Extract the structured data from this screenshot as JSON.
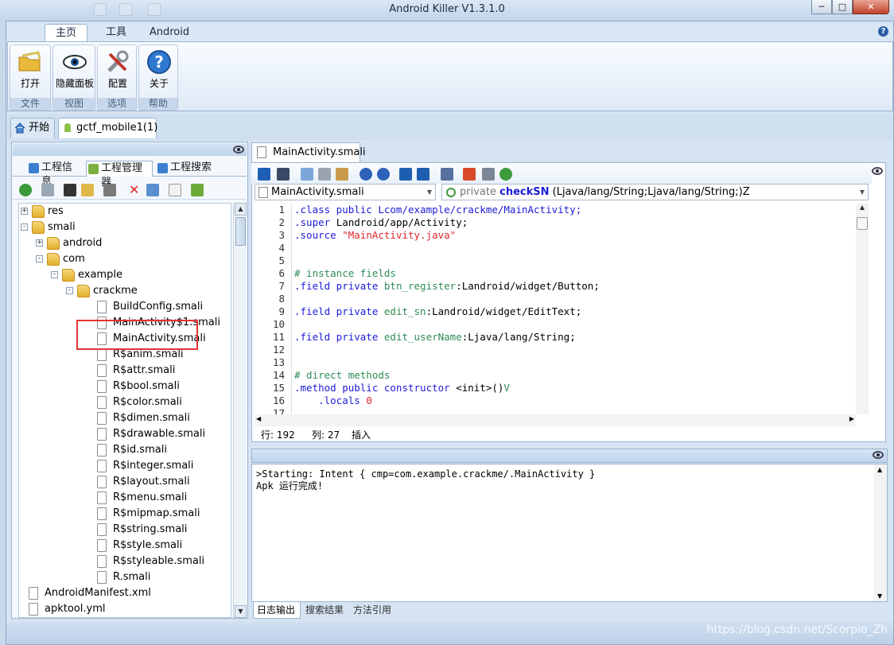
{
  "window": {
    "title": "Android Killer V1.3.1.0",
    "min_label": "─",
    "max_label": "□",
    "close_label": "✕"
  },
  "ribbon": {
    "tabs": [
      {
        "label": "主页"
      },
      {
        "label": "工具"
      },
      {
        "label": "Android"
      }
    ],
    "help_label": "?",
    "groups": [
      {
        "button": "打开",
        "label": "文件",
        "icon": "open-folder-icon"
      },
      {
        "button": "隐藏面板",
        "label": "视图",
        "icon": "eye-icon"
      },
      {
        "button": "配置",
        "label": "选项",
        "icon": "tools-icon"
      },
      {
        "button": "关于",
        "label": "帮助",
        "icon": "help-icon"
      }
    ]
  },
  "doc_tabs": [
    {
      "label": "开始",
      "icon": "home-icon"
    },
    {
      "label": "gctf_mobile1(1)",
      "icon": "android-icon"
    }
  ],
  "left_panel": {
    "tabs": [
      {
        "label": "工程信息"
      },
      {
        "label": "工程管理器"
      },
      {
        "label": "工程搜索"
      }
    ],
    "tree": [
      {
        "label": "res",
        "type": "folder",
        "level": 0,
        "toggle": "+"
      },
      {
        "label": "smali",
        "type": "folder",
        "level": 0,
        "toggle": "-"
      },
      {
        "label": "android",
        "type": "folder",
        "level": 1,
        "toggle": "+"
      },
      {
        "label": "com",
        "type": "folder",
        "level": 1,
        "toggle": "-"
      },
      {
        "label": "example",
        "type": "folder",
        "level": 2,
        "toggle": "-"
      },
      {
        "label": "crackme",
        "type": "folder",
        "level": 3,
        "toggle": "-"
      },
      {
        "label": "BuildConfig.smali",
        "type": "file",
        "level": 4
      },
      {
        "label": "MainActivity$1.smali",
        "type": "file",
        "level": 4
      },
      {
        "label": "MainActivity.smali",
        "type": "file",
        "level": 4
      },
      {
        "label": "R$anim.smali",
        "type": "file",
        "level": 4
      },
      {
        "label": "R$attr.smali",
        "type": "file",
        "level": 4
      },
      {
        "label": "R$bool.smali",
        "type": "file",
        "level": 4
      },
      {
        "label": "R$color.smali",
        "type": "file",
        "level": 4
      },
      {
        "label": "R$dimen.smali",
        "type": "file",
        "level": 4
      },
      {
        "label": "R$drawable.smali",
        "type": "file",
        "level": 4
      },
      {
        "label": "R$id.smali",
        "type": "file",
        "level": 4
      },
      {
        "label": "R$integer.smali",
        "type": "file",
        "level": 4
      },
      {
        "label": "R$layout.smali",
        "type": "file",
        "level": 4
      },
      {
        "label": "R$menu.smali",
        "type": "file",
        "level": 4
      },
      {
        "label": "R$mipmap.smali",
        "type": "file",
        "level": 4
      },
      {
        "label": "R$string.smali",
        "type": "file",
        "level": 4
      },
      {
        "label": "R$style.smali",
        "type": "file",
        "level": 4
      },
      {
        "label": "R$styleable.smali",
        "type": "file",
        "level": 4
      },
      {
        "label": "R.smali",
        "type": "file",
        "level": 4
      },
      {
        "label": "AndroidManifest.xml",
        "type": "file",
        "level": 0
      },
      {
        "label": "apktool.yml",
        "type": "file",
        "level": 0
      }
    ]
  },
  "editor": {
    "tab_label": "MainActivity.smali",
    "file_combo": "MainActivity.smali",
    "method_combo": {
      "modifier": "private",
      "name": "checkSN",
      "signature": "(Ljava/lang/String;Ljava/lang/String;)Z"
    },
    "lines": [
      {
        "n": "1",
        "parts": [
          [
            ".class public Lcom/example/crackme/MainActivity;",
            "kw"
          ]
        ]
      },
      {
        "n": "2",
        "parts": [
          [
            ".super ",
            "kw"
          ],
          [
            "Landroid/app/Activity;",
            "plain"
          ]
        ]
      },
      {
        "n": "3",
        "parts": [
          [
            ".source ",
            "kw"
          ],
          [
            "\"MainActivity.java\"",
            "str"
          ]
        ]
      },
      {
        "n": "4",
        "parts": []
      },
      {
        "n": "5",
        "parts": []
      },
      {
        "n": "6",
        "parts": [
          [
            "# instance fields",
            "com"
          ]
        ]
      },
      {
        "n": "7",
        "parts": [
          [
            ".field private ",
            "kw"
          ],
          [
            "btn_register",
            "fld"
          ],
          [
            ":Landroid/widget/Button;",
            "plain"
          ]
        ]
      },
      {
        "n": "8",
        "parts": []
      },
      {
        "n": "9",
        "parts": [
          [
            ".field private ",
            "kw"
          ],
          [
            "edit_sn",
            "fld"
          ],
          [
            ":Landroid/widget/EditText;",
            "plain"
          ]
        ]
      },
      {
        "n": "10",
        "parts": []
      },
      {
        "n": "11",
        "parts": [
          [
            ".field private ",
            "kw"
          ],
          [
            "edit_userName",
            "fld"
          ],
          [
            ":Ljava/lang/String;",
            "plain"
          ]
        ]
      },
      {
        "n": "12",
        "parts": []
      },
      {
        "n": "13",
        "parts": []
      },
      {
        "n": "14",
        "parts": [
          [
            "# direct methods",
            "com"
          ]
        ]
      },
      {
        "n": "15",
        "parts": [
          [
            ".method public constructor ",
            "kw"
          ],
          [
            "<init>",
            "plain"
          ],
          [
            "()",
            "plain"
          ],
          [
            "V",
            "fld"
          ]
        ]
      },
      {
        "n": "16",
        "parts": [
          [
            "    .locals ",
            "kw"
          ],
          [
            "0",
            "str"
          ]
        ]
      },
      {
        "n": "17",
        "parts": []
      }
    ],
    "status": {
      "row_label": "行: 192",
      "col_label": "列: 27",
      "mode": "插入"
    }
  },
  "log": {
    "lines": [
      ">Starting: Intent { cmp=com.example.crackme/.MainActivity }",
      "Apk 运行完成!"
    ],
    "tabs": [
      {
        "label": "日志输出"
      },
      {
        "label": "搜索结果"
      },
      {
        "label": "方法引用"
      }
    ]
  },
  "watermark": "https://blog.csdn.net/Scorpio_Zh",
  "colors": {
    "keyword": "#1b1bd6",
    "string": "#e0262e",
    "comment": "#2e8b57",
    "field": "#2e8b57",
    "highlight": "#e53333"
  }
}
